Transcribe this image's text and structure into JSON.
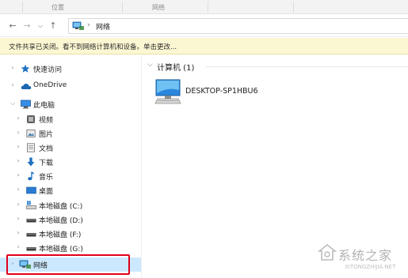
{
  "ribbon": {
    "groups": [
      "位置",
      "网络"
    ]
  },
  "navbar": {
    "back_icon": "←",
    "forward_icon": "→",
    "dropdown_icon": "⌵",
    "up_icon": "↑",
    "path_separator": "›",
    "path": "网络"
  },
  "infobar": {
    "text": "文件共享已关闭。看不到网络计算机和设备。单击更改..."
  },
  "tree": {
    "quick_access": "快速访问",
    "onedrive": "OneDrive",
    "this_pc": "此电脑",
    "videos": "视频",
    "pictures": "图片",
    "documents": "文档",
    "downloads": "下载",
    "music": "音乐",
    "desktop": "桌面",
    "drive_c": "本地磁盘 (C:)",
    "drive_d": "本地磁盘 (D:)",
    "drive_f": "本地磁盘 (F:)",
    "drive_g": "本地磁盘 (G:)",
    "network": "网络",
    "chevron_collapsed": "›",
    "chevron_expanded": "⌵"
  },
  "content": {
    "group_chevron": "⌵",
    "group_title": "计算机 (1)",
    "computer_name": "DESKTOP-SP1HBU6"
  },
  "watermark": {
    "text": "系统之家",
    "url": "XITONGZHIJIA.NET"
  },
  "colors": {
    "accent": "#0078d7",
    "selection": "#cce8ff",
    "infobar": "#fcf7d3",
    "highlight_box": "#e0001b"
  }
}
